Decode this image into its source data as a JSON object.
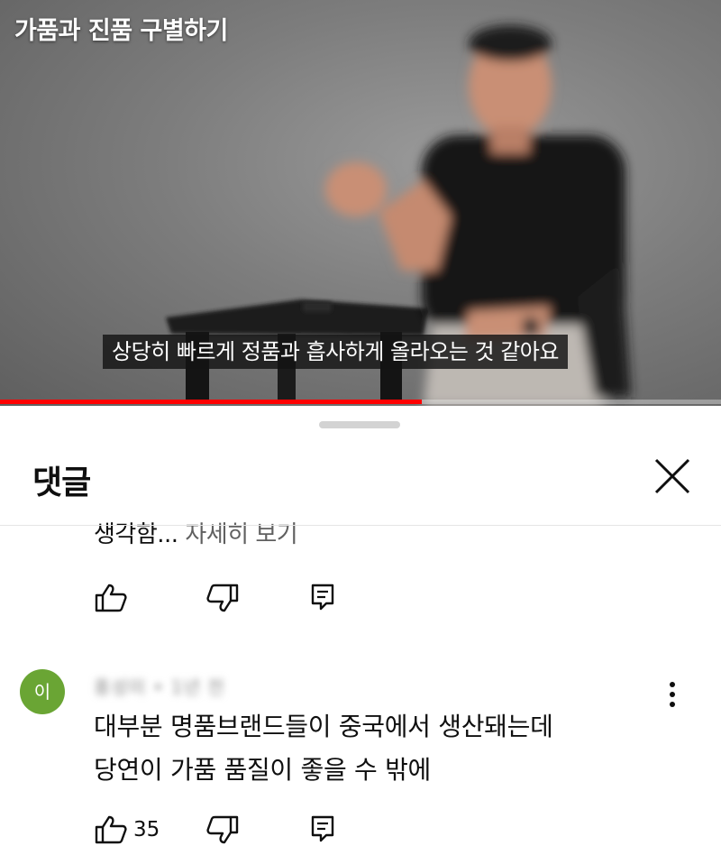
{
  "video": {
    "title": "가품과 진품 구별하기",
    "subtitle": "상당히 빠르게 정품과 흡사하게 올라오는 것 같아요",
    "progress_percent": 58.5
  },
  "comments_sheet": {
    "title": "댓글",
    "close_icon": "close-icon",
    "previous_comment": {
      "truncated_text": "생각함...",
      "read_more_label": "자세히 보기",
      "actions": [
        "like-icon",
        "dislike-icon",
        "reply-icon"
      ]
    },
    "comment": {
      "avatar_letter": "이",
      "avatar_color": "#6aa534",
      "meta": "홍성미 • 1년 전",
      "lines": [
        "대부분 명품브랜드들이 중국에서 생산돼는데",
        "당연이 가품 품질이 좋을 수 밖에"
      ],
      "like_count": "35",
      "actions": [
        "like-icon",
        "dislike-icon",
        "reply-icon"
      ],
      "menu_icon": "more-vert-icon"
    }
  }
}
